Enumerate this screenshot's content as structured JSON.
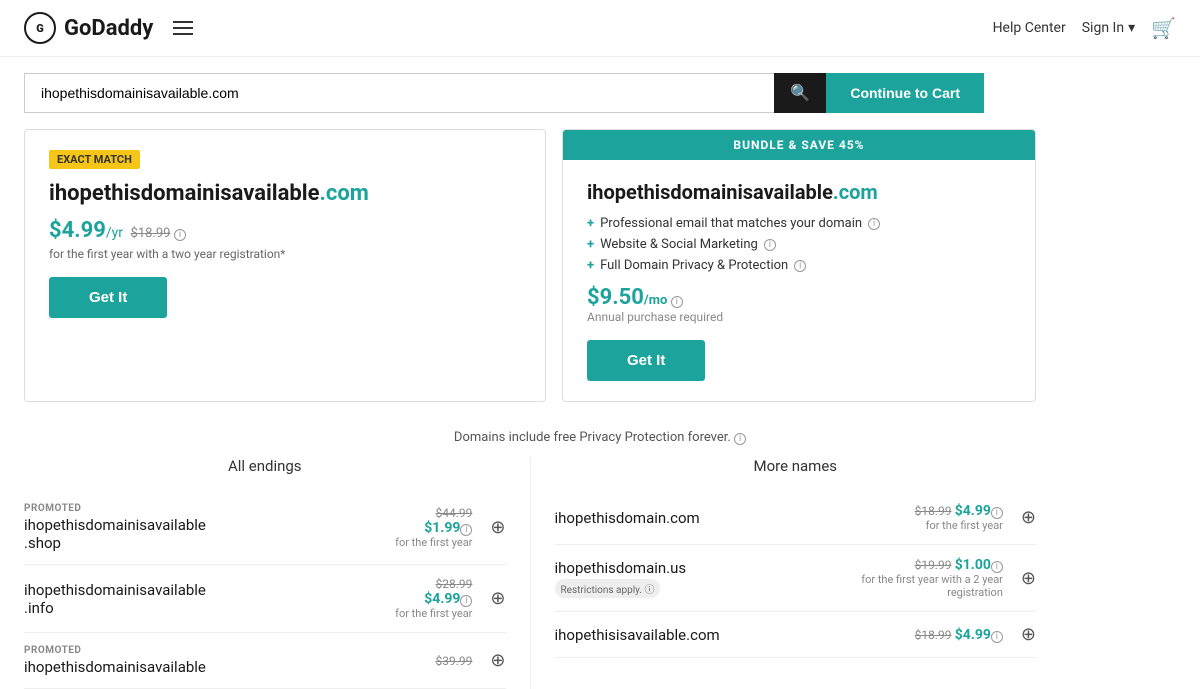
{
  "header": {
    "logo_text": "GoDaddy",
    "help_center": "Help Center",
    "sign_in": "Sign In",
    "cart_icon": "🛒"
  },
  "search": {
    "input_value": "ihopethisdomainisavailable.com",
    "search_icon": "🔍",
    "continue_button": "Continue to Cart"
  },
  "exact_match": {
    "badge": "EXACT MATCH",
    "domain_base": "ihopethisdomainisavailable",
    "domain_tld": ".com",
    "price_main": "$4.99",
    "price_unit": "/yr",
    "price_original": "$18.99",
    "price_info_icon": "ⓘ",
    "price_note": "for the first year with a two year registration*",
    "get_it_label": "Get It"
  },
  "bundle": {
    "header": "BUNDLE & SAVE 45%",
    "domain_base": "ihopethisdomainisavailable",
    "domain_tld": ".com",
    "features": [
      "Professional email that matches your domain",
      "Website & Social Marketing",
      "Full Domain Privacy & Protection"
    ],
    "price_main": "$9.50",
    "price_unit": "/mo",
    "price_note": "Annual purchase required",
    "get_it_label": "Get It"
  },
  "privacy_note": "Domains include free Privacy Protection forever.",
  "all_endings_title": "All endings",
  "more_names_title": "More names",
  "all_endings": [
    {
      "promoted": true,
      "name": "ihopethisdomainisavailable.shop",
      "old_price": "$44.99",
      "new_price": "$1.99",
      "price_note": "for the first year"
    },
    {
      "promoted": false,
      "name": "ihopethisdomainisavailable.info",
      "old_price": "$28.99",
      "new_price": "$4.99",
      "price_note": "for the first year"
    },
    {
      "promoted": true,
      "name": "ihopethisdomainisavailable",
      "old_price": "$39.99",
      "new_price": "",
      "price_note": ""
    }
  ],
  "more_names": [
    {
      "name": "ihopethisdomain.com",
      "old_price": "$18.99",
      "new_price": "$4.99",
      "price_note": "for the first year",
      "restriction": false
    },
    {
      "name": "ihopethisdomain.us",
      "old_price": "$19.99",
      "new_price": "$1.00",
      "price_note": "for the first year with a 2 year registration",
      "restriction": true,
      "restriction_label": "Restrictions apply."
    },
    {
      "name": "ihopethisisavailable.com",
      "old_price": "$18.99",
      "new_price": "$4.99",
      "price_note": "",
      "restriction": false
    }
  ]
}
